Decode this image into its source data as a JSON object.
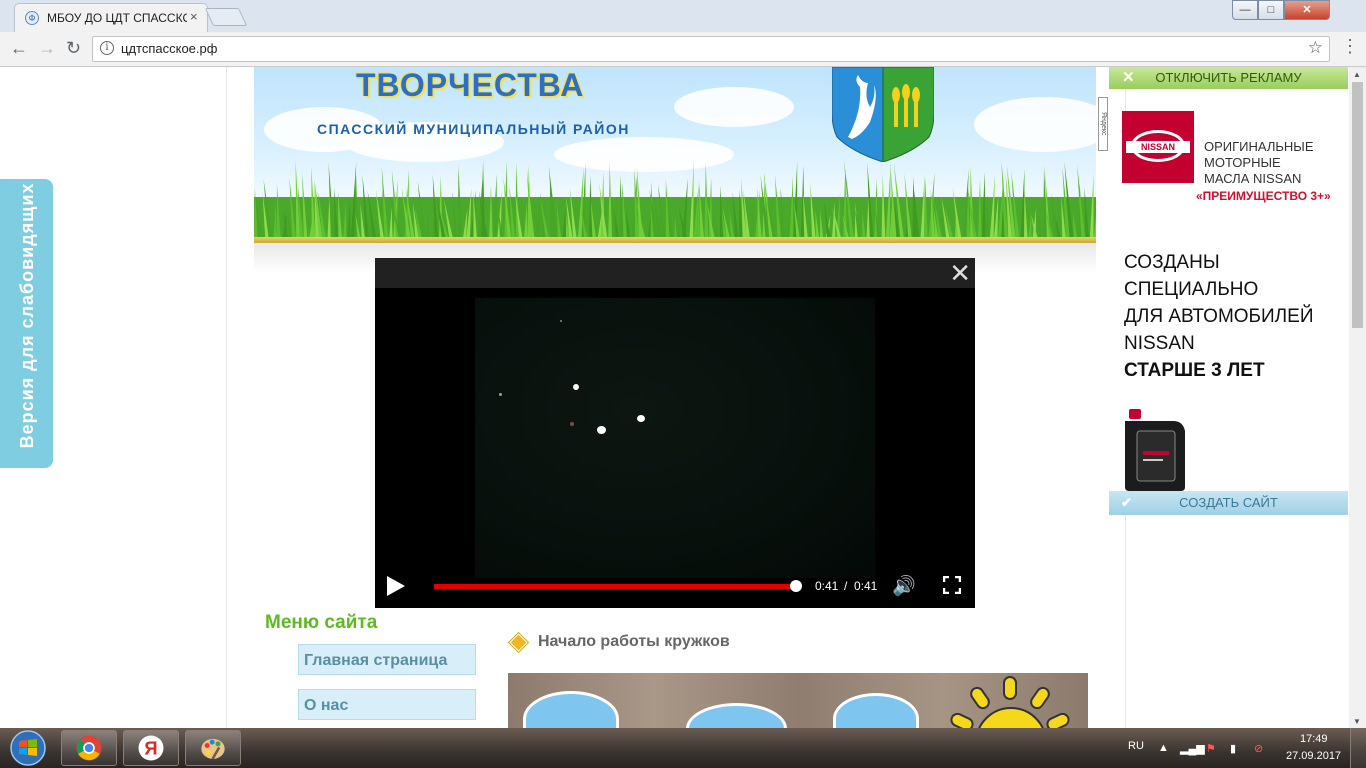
{
  "browser": {
    "tab_title": "МБОУ ДО ЦДТ СПАССКОГО",
    "tab_close": "×",
    "url": "цдтспасское.рф",
    "back_icon": "←",
    "forward_icon": "→",
    "reload_icon": "↻",
    "star_icon": "☆",
    "menu_icon": "⋮",
    "info_icon": "i"
  },
  "window_controls": {
    "minimize": "—",
    "maximize": "□",
    "close": "✕"
  },
  "header": {
    "title": "ТВОРЧЕСТВА",
    "subtitle": "СПАССКИЙ МУНИЦИПАЛЬНЫЙ РАЙОН"
  },
  "low_vision": {
    "label": "Версия для слабовидящих"
  },
  "video": {
    "close": "✕",
    "current_time": "0:41",
    "separator": "/",
    "total_time": "0:41",
    "progress": 1.0,
    "volume_icon": "🔊"
  },
  "menu": {
    "title": "Меню сайта",
    "items": [
      {
        "label": "Главная страница"
      },
      {
        "label": "О нас"
      }
    ]
  },
  "news": {
    "title": "Начало работы кружков"
  },
  "ads": {
    "off_label": "ОТКЛЮЧИТЬ РЕКЛАМУ",
    "off_icon": "✕",
    "marker": "Яндекс",
    "brand": "NISSAN",
    "line1": "ОРИГИНАЛЬНЫЕ",
    "line2": "МОТОРНЫЕ",
    "line3": "МАСЛА NISSAN",
    "promo": "«ПРЕИМУЩЕСТВО 3+»",
    "big1": "СОЗДАНЫ",
    "big2": "СПЕЦИАЛЬНО",
    "big3": "ДЛЯ АВТОМОБИЛЕЙ",
    "big4": "NISSAN",
    "big5": "СТАРШЕ 3 ЛЕТ",
    "create_label": "СОЗДАТЬ САЙТ",
    "create_icon": "✔"
  },
  "taskbar": {
    "language": "RU",
    "time": "17:49",
    "date": "27.09.2017"
  },
  "colors": {
    "accent_green": "#5cbc1d",
    "progress_red": "#e00000",
    "nissan_red": "#c3002f",
    "menu_bg": "#d8effa"
  }
}
